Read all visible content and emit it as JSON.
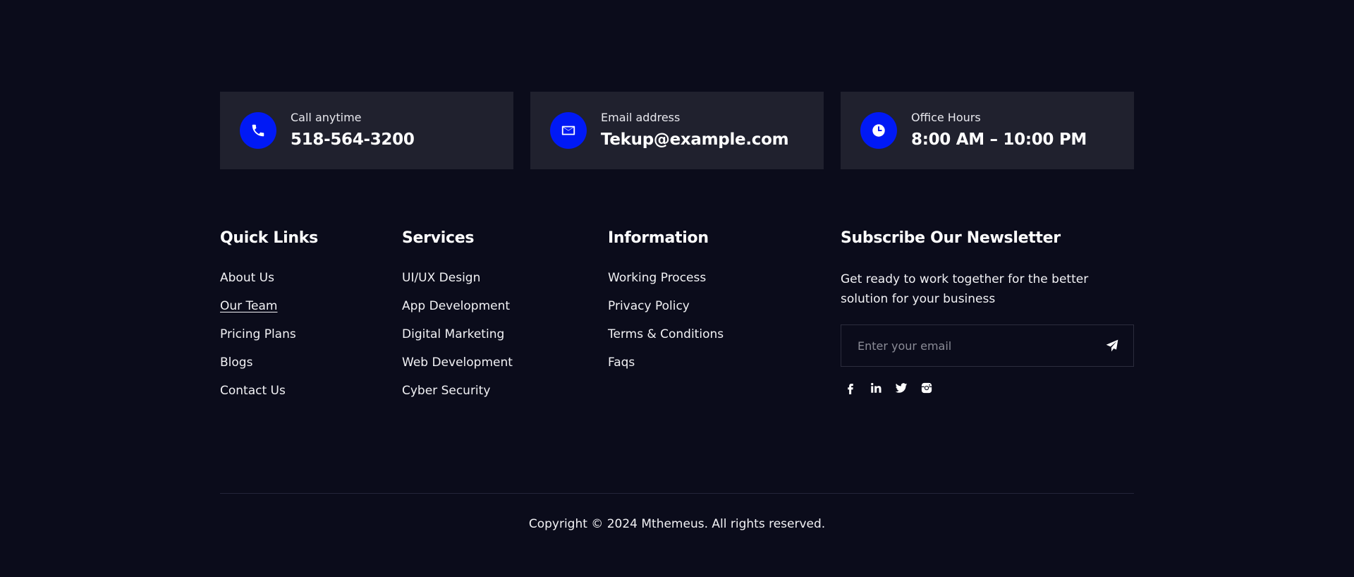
{
  "contacts": [
    {
      "label": "Call anytime",
      "value": "518-564-3200",
      "icon": "phone-icon"
    },
    {
      "label": "Email address",
      "value": "Tekup@example.com",
      "icon": "mail-icon"
    },
    {
      "label": "Office Hours",
      "value": "8:00 AM – 10:00 PM",
      "icon": "clock-icon"
    }
  ],
  "quick_links": {
    "title": "Quick Links",
    "items": [
      "About Us",
      "Our Team",
      "Pricing Plans",
      "Blogs",
      "Contact Us"
    ]
  },
  "services": {
    "title": "Services",
    "items": [
      "UI/UX Design",
      "App Development",
      "Digital Marketing",
      "Web Development",
      "Cyber Security"
    ]
  },
  "information": {
    "title": "Information",
    "items": [
      "Working Process",
      "Privacy Policy",
      "Terms & Conditions",
      "Faqs"
    ]
  },
  "newsletter": {
    "title": "Subscribe Our Newsletter",
    "description": "Get ready to work together for the better solution for your business",
    "email_placeholder": "Enter your email",
    "email_value": "",
    "send_icon": "send-icon"
  },
  "socials": [
    "facebook-icon",
    "linkedin-icon",
    "twitter-icon",
    "instagram-icon"
  ],
  "copyright": "Copyright © 2024 Mthemeus. All rights reserved.",
  "colors": {
    "background": "#0b0c1b",
    "card": "#20212e",
    "accent": "#0019f5",
    "text": "#ffffff"
  }
}
